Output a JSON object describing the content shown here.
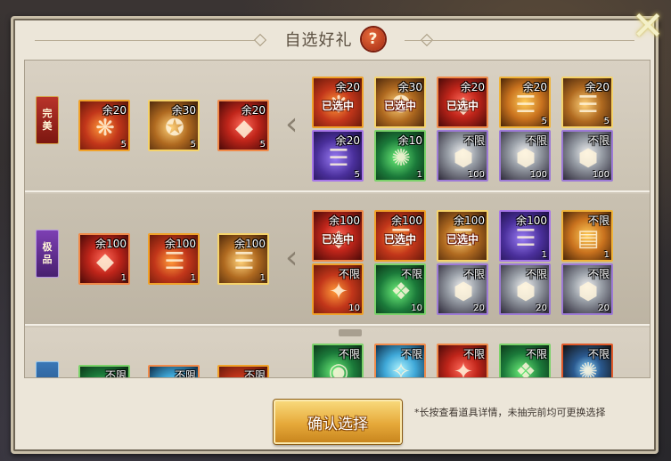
{
  "title": "自选好礼",
  "help_icon": "?",
  "close_icon": "✕",
  "confirm_label": "确认选择",
  "hint": "*长按查看道具详情，未抽完前均可更换选择",
  "tiers": [
    {
      "tag": [
        "完",
        "美"
      ],
      "style": "perfect",
      "pool": [
        {
          "style": "orange",
          "glyph": "❋",
          "remain": "余20",
          "count": "5"
        },
        {
          "style": "gold",
          "glyph": "✪",
          "remain": "余30",
          "count": "5"
        },
        {
          "style": "red",
          "glyph": "◆",
          "remain": "余20",
          "count": "5"
        }
      ],
      "picks": [
        {
          "style": "orange",
          "glyph": "❋",
          "remain": "余20",
          "count": "",
          "selected": "已选中"
        },
        {
          "style": "gold",
          "glyph": "✪",
          "remain": "余30",
          "count": "",
          "selected": "已选中"
        },
        {
          "style": "red",
          "glyph": "◆",
          "remain": "余20",
          "count": "",
          "selected": "已选中"
        },
        {
          "style": "book",
          "glyph": "☰",
          "remain": "余20",
          "count": "5",
          "selected": ""
        },
        {
          "style": "gold",
          "glyph": "☰",
          "remain": "余20",
          "count": "5",
          "selected": ""
        },
        {
          "style": "purple",
          "glyph": "☰",
          "remain": "余20",
          "count": "5",
          "selected": ""
        },
        {
          "style": "green",
          "glyph": "✺",
          "remain": "余10",
          "count": "1",
          "selected": ""
        },
        {
          "style": "silver",
          "glyph": "⬢",
          "remain": "不限",
          "count": "100",
          "selected": ""
        },
        {
          "style": "silver",
          "glyph": "⬢",
          "remain": "不限",
          "count": "100",
          "selected": ""
        },
        {
          "style": "silver",
          "glyph": "⬢",
          "remain": "不限",
          "count": "100",
          "selected": ""
        }
      ]
    },
    {
      "tag": [
        "极",
        "品"
      ],
      "style": "extreme",
      "pool": [
        {
          "style": "red",
          "glyph": "◆",
          "remain": "余100",
          "count": "1"
        },
        {
          "style": "orange",
          "glyph": "☰",
          "remain": "余100",
          "count": "1"
        },
        {
          "style": "gold",
          "glyph": "☰",
          "remain": "余100",
          "count": "1"
        }
      ],
      "picks": [
        {
          "style": "red",
          "glyph": "◆",
          "remain": "余100",
          "count": "",
          "selected": "已选中"
        },
        {
          "style": "orange",
          "glyph": "☰",
          "remain": "余100",
          "count": "",
          "selected": "已选中"
        },
        {
          "style": "gold",
          "glyph": "☰",
          "remain": "余100",
          "count": "",
          "selected": "已选中"
        },
        {
          "style": "purple",
          "glyph": "☰",
          "remain": "余100",
          "count": "1",
          "selected": ""
        },
        {
          "style": "book",
          "glyph": "▤",
          "remain": "不限",
          "count": "1",
          "selected": ""
        },
        {
          "style": "orange",
          "glyph": "✦",
          "remain": "不限",
          "count": "10",
          "selected": ""
        },
        {
          "style": "green",
          "glyph": "❖",
          "remain": "不限",
          "count": "10",
          "selected": ""
        },
        {
          "style": "silver",
          "glyph": "⬢",
          "remain": "不限",
          "count": "20",
          "selected": ""
        },
        {
          "style": "silver",
          "glyph": "⬢",
          "remain": "不限",
          "count": "20",
          "selected": ""
        },
        {
          "style": "silver",
          "glyph": "⬢",
          "remain": "不限",
          "count": "20",
          "selected": ""
        }
      ]
    },
    {
      "tag": [
        "",
        ""
      ],
      "style": "blue",
      "pool": [
        {
          "style": "green",
          "glyph": "❖",
          "remain": "不限",
          "count": ""
        },
        {
          "style": "cyan",
          "glyph": "✧",
          "remain": "不限",
          "count": ""
        },
        {
          "style": "orange",
          "glyph": "✦",
          "remain": "不限",
          "count": ""
        }
      ],
      "picks": [
        {
          "style": "green",
          "glyph": "◉",
          "remain": "不限",
          "count": "",
          "selected": ""
        },
        {
          "style": "cyan",
          "glyph": "✧",
          "remain": "不限",
          "count": "",
          "selected": ""
        },
        {
          "style": "red",
          "glyph": "✦",
          "remain": "不限",
          "count": "",
          "selected": ""
        },
        {
          "style": "green",
          "glyph": "❖",
          "remain": "不限",
          "count": "",
          "selected": ""
        },
        {
          "style": "dark",
          "glyph": "✺",
          "remain": "不限",
          "count": "",
          "selected": ""
        }
      ]
    }
  ]
}
